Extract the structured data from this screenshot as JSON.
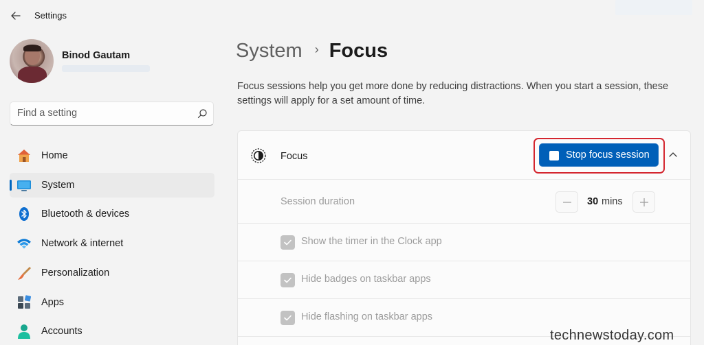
{
  "window": {
    "title": "Settings"
  },
  "profile": {
    "name": "Binod Gautam"
  },
  "search": {
    "placeholder": "Find a setting"
  },
  "sidebar": {
    "items": [
      {
        "label": "Home",
        "icon": "home-icon"
      },
      {
        "label": "System",
        "icon": "system-icon",
        "active": true
      },
      {
        "label": "Bluetooth & devices",
        "icon": "bluetooth-icon"
      },
      {
        "label": "Network & internet",
        "icon": "wifi-icon"
      },
      {
        "label": "Personalization",
        "icon": "brush-icon"
      },
      {
        "label": "Apps",
        "icon": "apps-icon"
      },
      {
        "label": "Accounts",
        "icon": "account-icon"
      }
    ]
  },
  "main": {
    "breadcrumb": {
      "parent": "System",
      "separator": "›",
      "current": "Focus"
    },
    "description": "Focus sessions help you get more done by reducing distractions. When you start a session, these settings will apply for a set amount of time.",
    "focus_card": {
      "title": "Focus",
      "stop_button_label": "Stop focus session",
      "session_duration": {
        "label": "Session duration",
        "value": "30",
        "unit": "mins"
      },
      "options": [
        {
          "label": "Show the timer in the Clock app",
          "checked": true,
          "disabled": true
        },
        {
          "label": "Hide badges on taskbar apps",
          "checked": true,
          "disabled": true
        },
        {
          "label": "Hide flashing on taskbar apps",
          "checked": true,
          "disabled": true
        }
      ]
    }
  },
  "watermark": "technewstoday.com",
  "colors": {
    "accent": "#005fb8",
    "highlight": "#d4262f",
    "background": "#f3f3f3"
  }
}
